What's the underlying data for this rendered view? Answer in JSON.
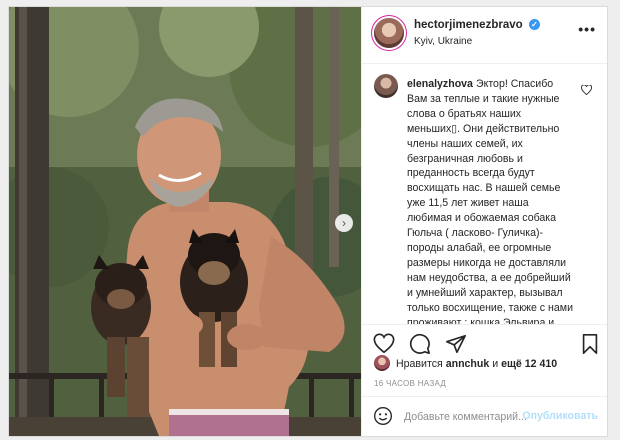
{
  "post": {
    "author": {
      "username": "hectorjimenezbravo",
      "verified": true,
      "location": "Kyiv, Ukraine"
    },
    "more_label": "•••",
    "carousel_next_glyph": "›",
    "comment": {
      "username": "elenalyzhova",
      "text": "Эктор! Спасибо Вам за теплые и такие нужные слова о братьях наших меньших▯. Они действительно члены наших семей, их безграничная любовь и преданность всегда будут восхищать нас. В нашей семье уже 11,5 лет живет наша любимая и обожаемая собака Гюльча ( ласково- Гуличка)- породы алабай, ее огромные размеры никогда не доставляли нам неудобства, а ее добрейший и умнейший характер, вызывал только восхищение, также с нами проживают : кошка Эльвира и котик Маркиз- это просто два комочка счастья!"
    },
    "likes": {
      "prefix": "Нравится",
      "user": "annchuk",
      "conjunction": "и",
      "count_text": "ещё 12 410"
    },
    "timestamp": "16 ЧАСОВ НАЗАД",
    "add_comment": {
      "placeholder": "Добавьте комментарий...",
      "publish_label": "Опубликовать"
    },
    "icons": [
      "heart-icon",
      "comment-icon",
      "share-icon",
      "bookmark-icon",
      "emoji-icon",
      "small-heart-icon",
      "verified-badge-icon",
      "more-options-icon",
      "chevron-right-icon"
    ],
    "colors": {
      "accent": "#3897f0",
      "publish_disabled": "#b2dffc",
      "muted": "#8e8e8e",
      "text": "#262626"
    }
  }
}
